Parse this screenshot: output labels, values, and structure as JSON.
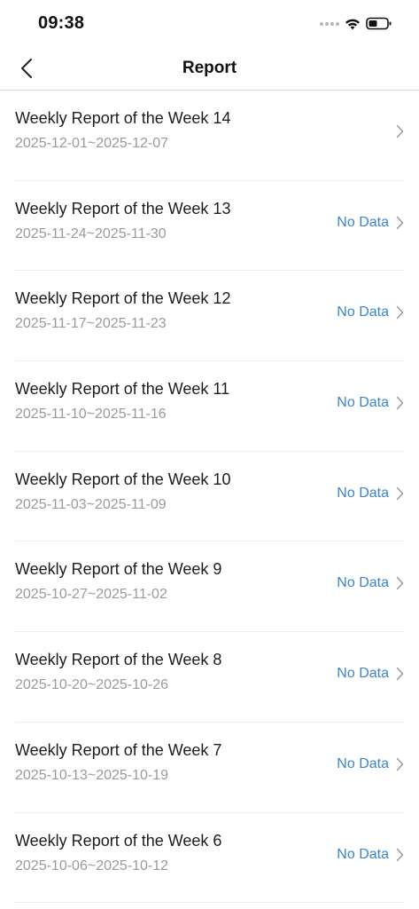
{
  "status_bar": {
    "time": "09:38",
    "icons": [
      "cellular-dots-icon",
      "wifi-icon",
      "battery-icon"
    ]
  },
  "nav": {
    "back_icon": "chevron-left-icon",
    "title": "Report"
  },
  "reports": [
    {
      "title": "Weekly Report of the Week 14",
      "dates": "2025-12-01~2025-12-07",
      "status": ""
    },
    {
      "title": "Weekly Report of the Week 13",
      "dates": "2025-11-24~2025-11-30",
      "status": "No Data"
    },
    {
      "title": "Weekly Report of the Week 12",
      "dates": "2025-11-17~2025-11-23",
      "status": "No Data"
    },
    {
      "title": "Weekly Report of the Week 11",
      "dates": "2025-11-10~2025-11-16",
      "status": "No Data"
    },
    {
      "title": "Weekly Report of the Week 10",
      "dates": "2025-11-03~2025-11-09",
      "status": "No Data"
    },
    {
      "title": "Weekly Report of the Week 9",
      "dates": "2025-10-27~2025-11-02",
      "status": "No Data"
    },
    {
      "title": "Weekly Report of the Week 8",
      "dates": "2025-10-20~2025-10-26",
      "status": "No Data"
    },
    {
      "title": "Weekly Report of the Week 7",
      "dates": "2025-10-13~2025-10-19",
      "status": "No Data"
    },
    {
      "title": "Weekly Report of the Week 6",
      "dates": "2025-10-06~2025-10-12",
      "status": "No Data"
    }
  ],
  "colors": {
    "accent": "#3a85c9",
    "secondary_text": "#9a9a9a",
    "divider": "#efefef"
  }
}
